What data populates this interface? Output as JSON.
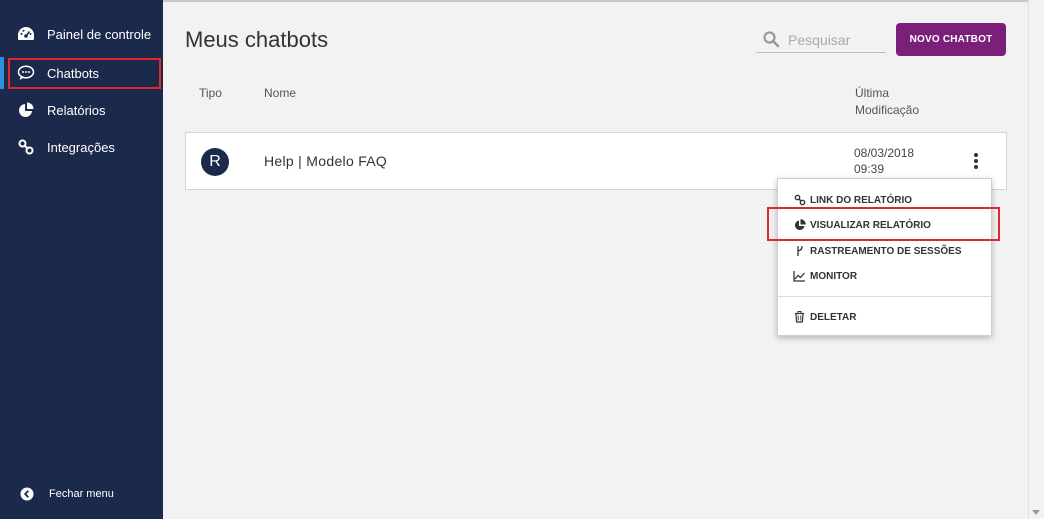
{
  "sidebar": {
    "items": [
      {
        "label": "Painel de controle",
        "icon": "dashboard-icon"
      },
      {
        "label": "Chatbots",
        "icon": "chat-bubble-icon"
      },
      {
        "label": "Relatórios",
        "icon": "pie-chart-icon"
      },
      {
        "label": "Integrações",
        "icon": "link-icon"
      }
    ],
    "active_item": "Chatbots",
    "footer_label": "Fechar menu"
  },
  "header": {
    "title": "Meus chatbots",
    "search_placeholder": "Pesquisar",
    "new_button_label": "NOVO CHATBOT"
  },
  "table": {
    "columns": {
      "tipo": "Tipo",
      "nome": "Nome",
      "modificacao_line1": "Última",
      "modificacao_line2": "Modificação"
    },
    "rows": [
      {
        "avatar_letter": "R",
        "name": "Help | Modelo FAQ",
        "date": "08/03/2018",
        "time": "09:39"
      }
    ]
  },
  "context_menu": {
    "items": [
      {
        "label": "LINK DO RELATÓRIO",
        "icon": "link-icon"
      },
      {
        "label": "VISUALIZAR RELATÓRIO",
        "icon": "pie-chart-icon"
      },
      {
        "label": "RASTREAMENTO DE SESSÕES",
        "icon": "fork-icon"
      },
      {
        "label": "MONITOR",
        "icon": "line-chart-icon"
      },
      {
        "label": "DELETAR",
        "icon": "trash-icon"
      }
    ]
  },
  "colors": {
    "sidebar_bg": "#1b2a4a",
    "primary_button": "#7a1f7a",
    "highlight": "#e0282e",
    "active_indicator": "#2f8fd8"
  }
}
